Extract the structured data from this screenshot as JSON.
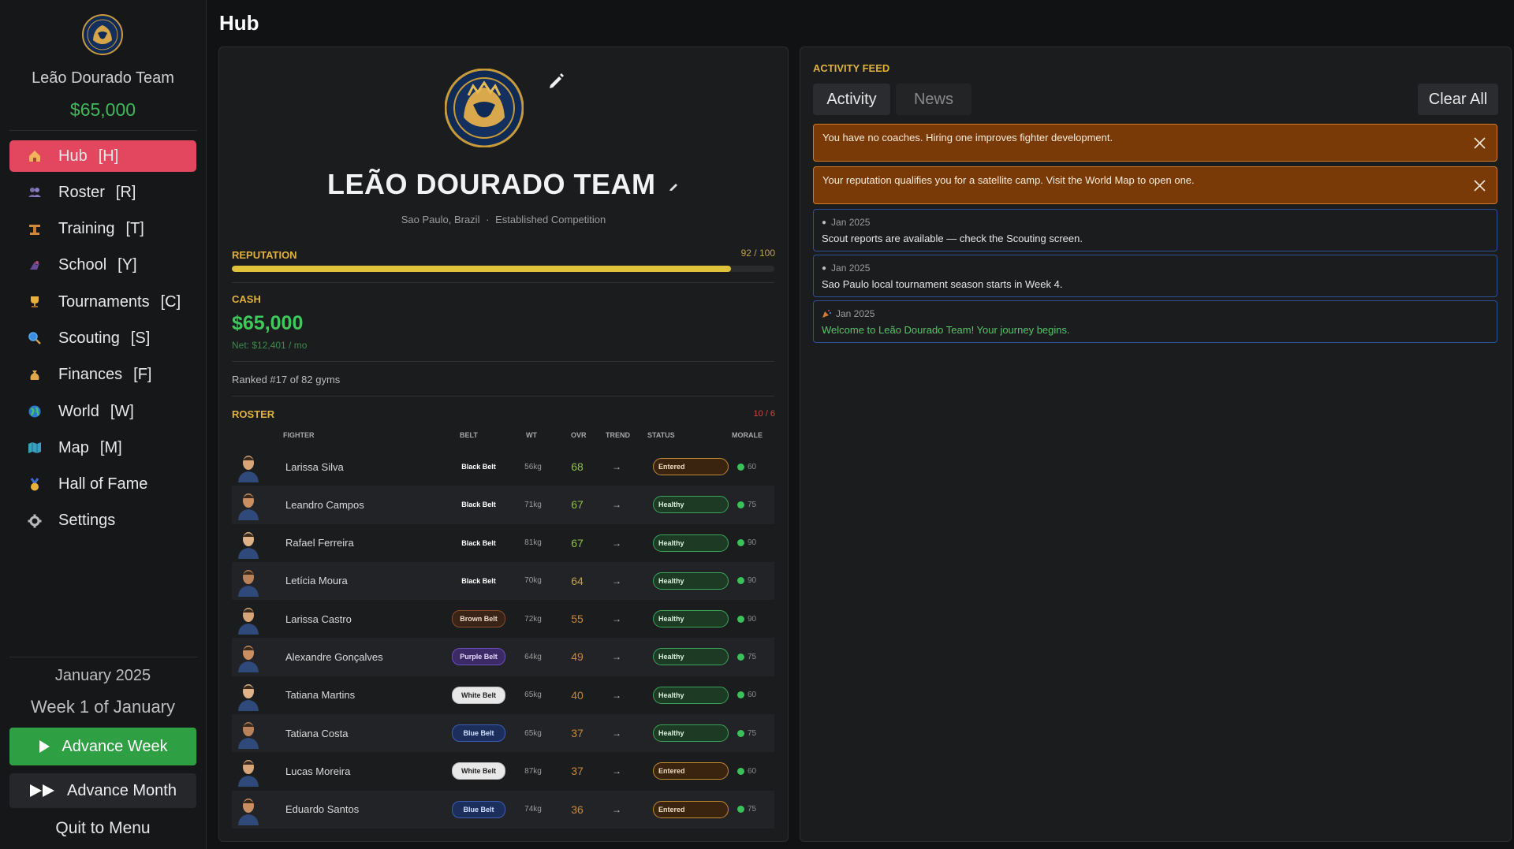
{
  "page": {
    "title": "Hub"
  },
  "sidebar": {
    "team_name": "Leão Dourado Team",
    "cash": "$65,000",
    "nav": [
      {
        "label": "Hub",
        "key": "[H]",
        "icon": "home-icon",
        "active": true
      },
      {
        "label": "Roster",
        "key": "[R]",
        "icon": "people-icon"
      },
      {
        "label": "Training",
        "key": "[T]",
        "icon": "dumbbell-icon"
      },
      {
        "label": "School",
        "key": "[Y]",
        "icon": "school-icon"
      },
      {
        "label": "Tournaments",
        "key": "[C]",
        "icon": "trophy-icon"
      },
      {
        "label": "Scouting",
        "key": "[S]",
        "icon": "magnifier-icon"
      },
      {
        "label": "Finances",
        "key": "[F]",
        "icon": "money-bag-icon"
      },
      {
        "label": "World",
        "key": "[W]",
        "icon": "globe-icon"
      },
      {
        "label": "Map",
        "key": "[M]",
        "icon": "map-icon"
      },
      {
        "label": "Hall of Fame",
        "key": "",
        "icon": "medal-icon"
      },
      {
        "label": "Settings",
        "key": "",
        "icon": "gear-icon"
      }
    ],
    "date": "January 2025",
    "week": "Week 1 of January",
    "advance_week": "Advance Week",
    "advance_month": "Advance Month",
    "quit": "Quit to Menu"
  },
  "team_card": {
    "name": "LEÃO DOURADO TEAM",
    "location": "Sao Paulo, Brazil",
    "separator": "·",
    "tier": "Established Competition",
    "reputation_label": "REPUTATION",
    "reputation_value": "92 / 100",
    "reputation_fraction": 0.92,
    "cash_label": "CASH",
    "cash": "$65,000",
    "net": "Net: $12,401 / mo",
    "ranked": "Ranked #17 of 82 gyms",
    "roster_label": "ROSTER",
    "roster_count": "10 / 6",
    "columns": [
      "FIGHTER",
      "BELT",
      "WT",
      "OVR",
      "TREND",
      "STATUS",
      "MORALE"
    ],
    "fighters": [
      {
        "name": "Larissa Silva",
        "belt": "Black Belt",
        "belt_class": "black",
        "wt": "56kg",
        "ovr": "68",
        "ovr_color": "#8fc04a",
        "trend": "→",
        "status": "Entered",
        "status_class": "entered",
        "morale": "60"
      },
      {
        "name": "Leandro Campos",
        "belt": "Black Belt",
        "belt_class": "black",
        "wt": "71kg",
        "ovr": "67",
        "ovr_color": "#8fc04a",
        "trend": "→",
        "status": "Healthy",
        "status_class": "healthy",
        "morale": "75"
      },
      {
        "name": "Rafael Ferreira",
        "belt": "Black Belt",
        "belt_class": "black",
        "wt": "81kg",
        "ovr": "67",
        "ovr_color": "#8fc04a",
        "trend": "→",
        "status": "Healthy",
        "status_class": "healthy",
        "morale": "90"
      },
      {
        "name": "Letícia Moura",
        "belt": "Black Belt",
        "belt_class": "black",
        "wt": "70kg",
        "ovr": "64",
        "ovr_color": "#c2a24c",
        "trend": "→",
        "status": "Healthy",
        "status_class": "healthy",
        "morale": "90"
      },
      {
        "name": "Larissa Castro",
        "belt": "Brown Belt",
        "belt_class": "brown",
        "wt": "72kg",
        "ovr": "55",
        "ovr_color": "#c9893a",
        "trend": "→",
        "status": "Healthy",
        "status_class": "healthy",
        "morale": "90"
      },
      {
        "name": "Alexandre Gonçalves",
        "belt": "Purple Belt",
        "belt_class": "purple",
        "wt": "64kg",
        "ovr": "49",
        "ovr_color": "#c9893a",
        "trend": "→",
        "status": "Healthy",
        "status_class": "healthy",
        "morale": "75"
      },
      {
        "name": "Tatiana Martins",
        "belt": "White Belt",
        "belt_class": "white",
        "wt": "65kg",
        "ovr": "40",
        "ovr_color": "#c9893a",
        "trend": "→",
        "status": "Healthy",
        "status_class": "healthy",
        "morale": "60"
      },
      {
        "name": "Tatiana Costa",
        "belt": "Blue Belt",
        "belt_class": "blue",
        "wt": "65kg",
        "ovr": "37",
        "ovr_color": "#c9893a",
        "trend": "→",
        "status": "Healthy",
        "status_class": "healthy",
        "morale": "75"
      },
      {
        "name": "Lucas Moreira",
        "belt": "White Belt",
        "belt_class": "white",
        "wt": "87kg",
        "ovr": "37",
        "ovr_color": "#c9893a",
        "trend": "→",
        "status": "Entered",
        "status_class": "entered",
        "morale": "60"
      },
      {
        "name": "Eduardo Santos",
        "belt": "Blue Belt",
        "belt_class": "blue",
        "wt": "74kg",
        "ovr": "36",
        "ovr_color": "#c9893a",
        "trend": "→",
        "status": "Entered",
        "status_class": "entered",
        "morale": "75"
      }
    ]
  },
  "feed": {
    "title": "ACTIVITY FEED",
    "tabs": [
      "Activity",
      "News"
    ],
    "clear_all": "Clear All",
    "alerts": [
      "You have no coaches. Hiring one improves fighter development.",
      "Your reputation qualifies you for a satellite camp. Visit the World Map to open one."
    ],
    "entries": [
      {
        "date": "Jan 2025",
        "text": "Scout reports are available — check the Scouting screen.",
        "icon": "bullet",
        "color": "normal"
      },
      {
        "date": "Jan 2025",
        "text": "Sao Paulo local tournament season starts in Week 4.",
        "icon": "bullet",
        "color": "normal"
      },
      {
        "date": "Jan 2025",
        "text": "Welcome to Leão Dourado Team! Your journey begins.",
        "icon": "party-icon",
        "color": "green"
      }
    ]
  },
  "colors": {
    "accent_active": "#e2475f",
    "cash_green": "#3fb95a",
    "section_gold": "#e0b23a",
    "alert_bg": "#7a3a08",
    "entry_border": "#2d4f9c"
  }
}
